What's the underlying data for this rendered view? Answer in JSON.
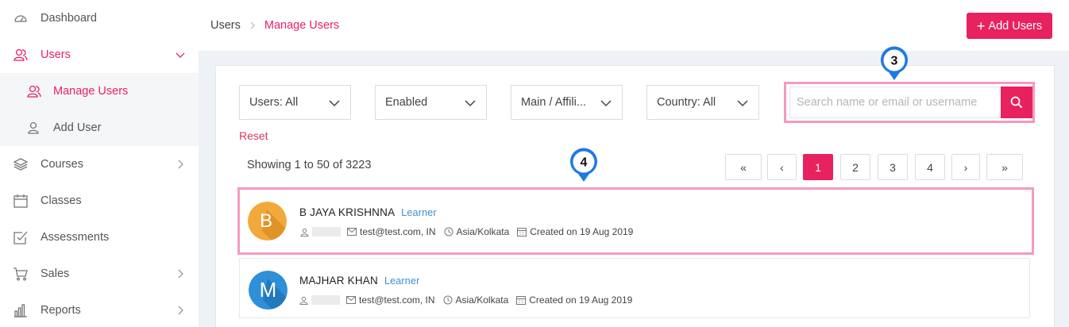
{
  "sidebar": {
    "items": [
      {
        "label": "Dashboard",
        "icon": "dashboard-icon"
      },
      {
        "label": "Users",
        "icon": "users-icon",
        "active": true
      },
      {
        "label": "Manage Users",
        "icon": "manage-users-icon",
        "active": true,
        "sub": true
      },
      {
        "label": "Add User",
        "icon": "add-user-icon",
        "sub": true
      },
      {
        "label": "Courses",
        "icon": "layers-icon"
      },
      {
        "label": "Classes",
        "icon": "calendar-icon"
      },
      {
        "label": "Assessments",
        "icon": "checkbox-icon"
      },
      {
        "label": "Sales",
        "icon": "cart-icon"
      },
      {
        "label": "Reports",
        "icon": "bar-chart-icon"
      }
    ]
  },
  "header": {
    "breadcrumb_root": "Users",
    "breadcrumb_current": "Manage Users",
    "add_button_label": "Add Users"
  },
  "filters": {
    "users": "Users: All",
    "status": "Enabled",
    "affiliation": "Main / Affili...",
    "country": "Country: All"
  },
  "search": {
    "placeholder": "Search name or email or username"
  },
  "reset_label": "Reset",
  "showing_text": "Showing 1 to 50 of 3223",
  "pagination": {
    "first": "«",
    "prev": "‹",
    "pages": [
      "1",
      "2",
      "3",
      "4"
    ],
    "current": "1",
    "next": "›",
    "last": "»"
  },
  "callouts": [
    "3",
    "4"
  ],
  "users": [
    {
      "initial": "B",
      "name": "B JAYA KRISHNNA",
      "role": "Learner",
      "email": "test@test.com, IN",
      "timezone": "Asia/Kolkata",
      "created": "Created on 19 Aug 2019",
      "avatar_color": "#f2a93b"
    },
    {
      "initial": "M",
      "name": "MAJHAR KHAN",
      "role": "Learner",
      "email": "test@test.com, IN",
      "timezone": "Asia/Kolkata",
      "created": "Created on 19 Aug 2019",
      "avatar_color": "#2f8fd8"
    }
  ],
  "colors": {
    "accent": "#e8215f",
    "highlight": "#f49ac0",
    "callout": "#1f7ae0",
    "role": "#3a8fd0"
  }
}
